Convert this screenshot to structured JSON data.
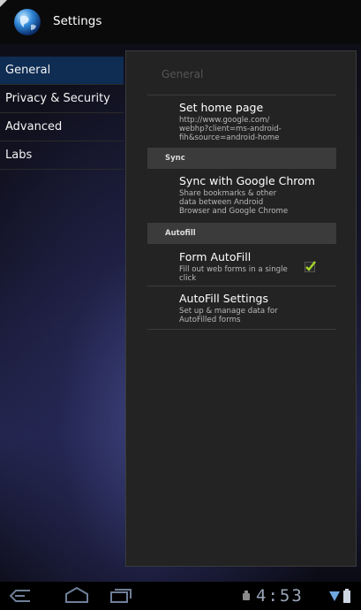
{
  "app": {
    "title": "Settings",
    "icon": "globe-icon"
  },
  "sidebar": {
    "items": [
      {
        "label": "General",
        "active": true
      },
      {
        "label": "Privacy & Security",
        "active": false
      },
      {
        "label": "Advanced",
        "active": false
      },
      {
        "label": "Labs",
        "active": false
      }
    ]
  },
  "panel": {
    "title": "General",
    "home_page": {
      "title": "Set home page",
      "summary": "http://www.google.com/ webhp?client=ms-android- fih&source=android-home"
    },
    "sync_category": "Sync",
    "sync": {
      "title": "Sync with Google Chrom",
      "summary": "Share bookmarks & other data between Android Browser and Google Chrome"
    },
    "autofill_category": "Autofill",
    "form_autofill": {
      "title": "Form AutoFill",
      "summary": "Fill out web forms in a single click",
      "checked": true
    },
    "autofill_settings": {
      "title": "AutoFill Settings",
      "summary": "Set up & manage data for AutoFilled forms"
    }
  },
  "system_bar": {
    "time": "4:53",
    "icons": [
      "back-icon",
      "home-icon",
      "recent-apps-icon",
      "android-debug-icon",
      "wifi-icon",
      "battery-icon"
    ]
  },
  "colors": {
    "accent_active": "#0f2c53",
    "check_green": "#a5d62a",
    "clock": "#9aa6b8"
  }
}
